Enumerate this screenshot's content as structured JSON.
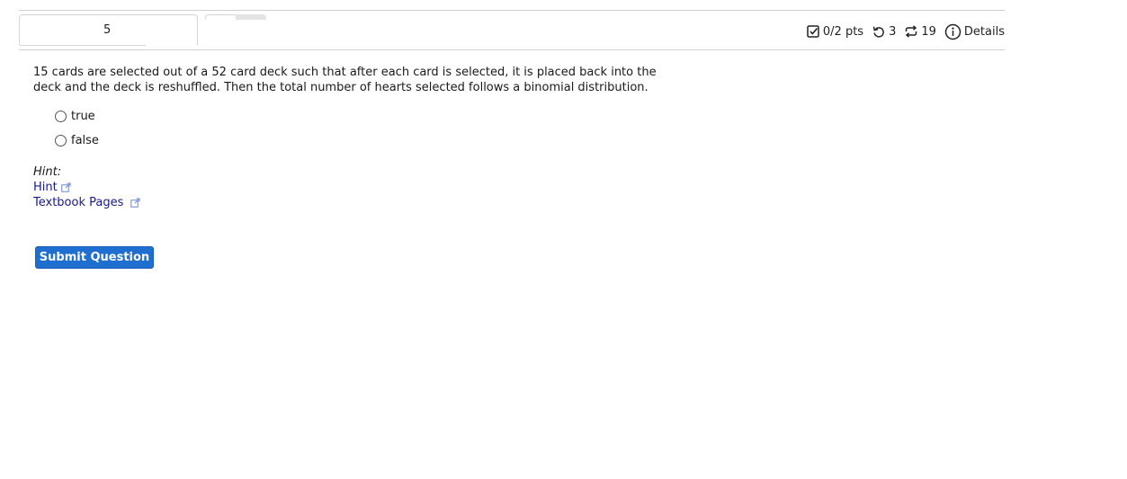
{
  "header": {
    "question_number": "5",
    "points": "0/2 pts",
    "retries": "3",
    "versions": "19",
    "details_label": "Details"
  },
  "question": {
    "text": "15 cards are selected out of a 52 card deck such that after each card is selected, it is placed back into the deck and the deck is reshuffled. Then the total number of hearts selected follows a binomial distribution.",
    "options": [
      {
        "label": "true"
      },
      {
        "label": "false"
      }
    ]
  },
  "hint": {
    "heading": "Hint:",
    "links": [
      {
        "label": "Hint"
      },
      {
        "label": "Textbook Pages"
      }
    ]
  },
  "actions": {
    "submit_label": "Submit Question"
  },
  "colors": {
    "accent": "#1f6fd0",
    "link": "#1a1a8a"
  }
}
